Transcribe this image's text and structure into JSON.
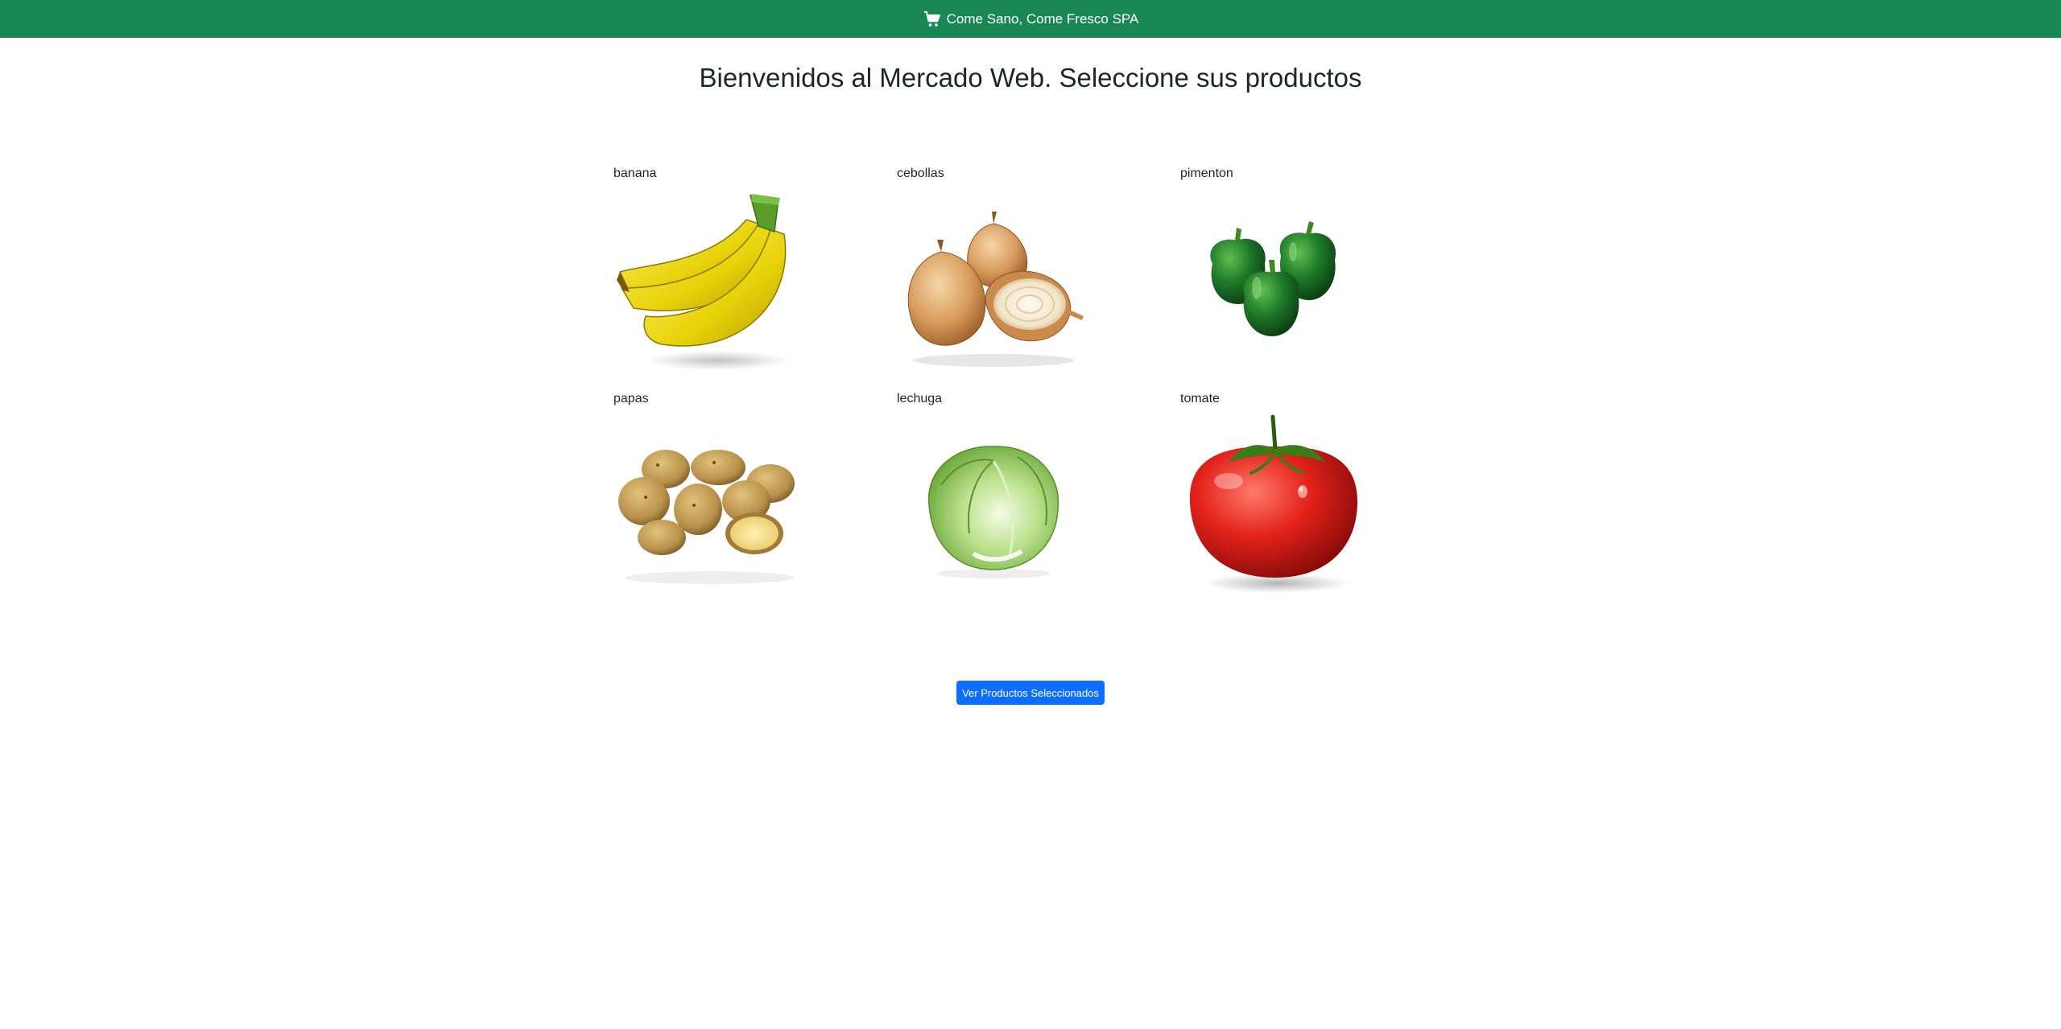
{
  "navbar": {
    "brand": "Come Sano, Come Fresco SPA",
    "icon": "cart-icon",
    "background": "#198754"
  },
  "page": {
    "title": "Bienvenidos al Mercado Web. Seleccione sus productos"
  },
  "products": [
    {
      "name": "banana",
      "icon": "banana-image"
    },
    {
      "name": "cebollas",
      "icon": "onion-image"
    },
    {
      "name": "pimenton",
      "icon": "bell-pepper-image"
    },
    {
      "name": "papas",
      "icon": "potatoes-image"
    },
    {
      "name": "lechuga",
      "icon": "lettuce-image"
    },
    {
      "name": "tomate",
      "icon": "tomato-image"
    }
  ],
  "actions": {
    "view_selected_label": "Ver Productos Seleccionados",
    "button_color": "#0d6efd"
  }
}
